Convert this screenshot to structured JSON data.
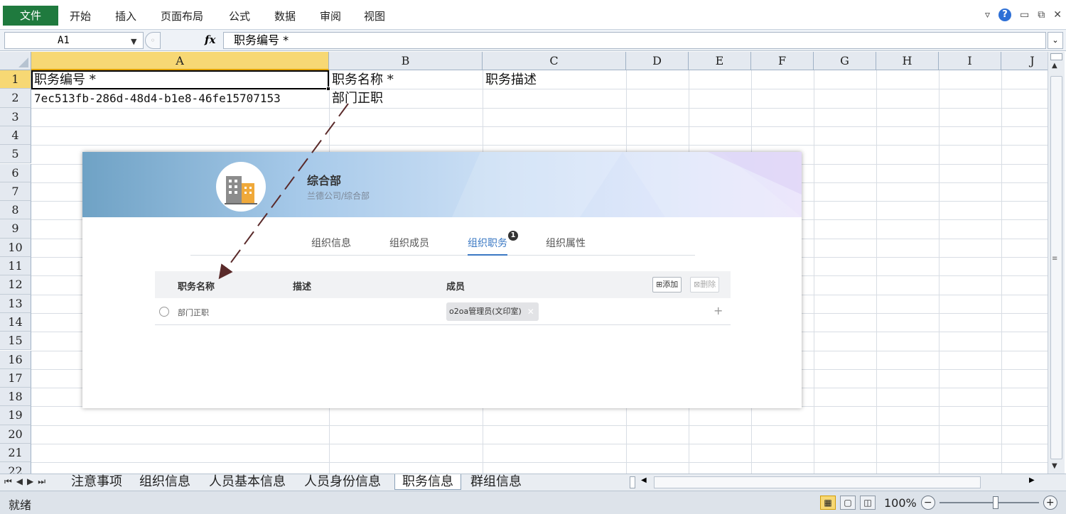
{
  "menubar": {
    "file_tab": "文件",
    "items": [
      "开始",
      "插入",
      "页面布局",
      "公式",
      "数据",
      "审阅",
      "视图"
    ]
  },
  "formula_bar": {
    "name_box": "A1",
    "fx_label": "fx",
    "formula": "职务编号 *"
  },
  "columns": [
    "A",
    "B",
    "C",
    "D",
    "E",
    "F",
    "G",
    "H",
    "I",
    "J"
  ],
  "rows": [
    "1",
    "2",
    "3",
    "4",
    "5",
    "6",
    "7",
    "8",
    "9",
    "10",
    "11",
    "12",
    "13",
    "14",
    "15",
    "16",
    "17",
    "18",
    "19",
    "20",
    "21",
    "22"
  ],
  "cells": {
    "A1": "职务编号 *",
    "B1": "职务名称 *",
    "C1": "职务描述",
    "A2": "7ec513fb-286d-48d4-b1e8-46fe15707153",
    "B2": "部门正职"
  },
  "sheet_tabs": [
    "注意事项",
    "组织信息",
    "人员基本信息",
    "人员身份信息",
    "职务信息",
    "群组信息"
  ],
  "active_sheet": "职务信息",
  "status": {
    "ready": "就绪",
    "zoom": "100%"
  },
  "org_panel": {
    "name": "综合部",
    "path": "兰德公司/综合部",
    "tabs": [
      "组织信息",
      "组织成员",
      "组织职务",
      "组织属性"
    ],
    "active_tab": "组织职务",
    "badge": "1",
    "table_headers": [
      "职务名称",
      "描述",
      "成员"
    ],
    "add_button": "添加",
    "delete_button": "删除",
    "row": {
      "post_name": "部门正职",
      "member": "o2oa管理员(文印室)"
    }
  },
  "colors": {
    "file_tab": "#1f7a3e",
    "selected_header": "#f7d874",
    "active_tab_text": "#3a78c3"
  }
}
